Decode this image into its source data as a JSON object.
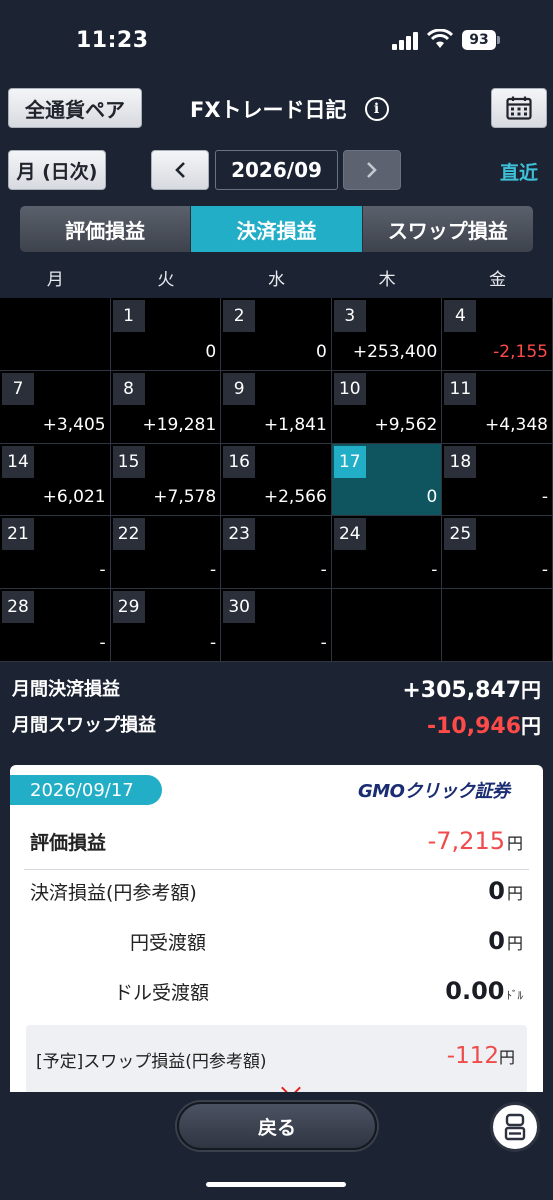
{
  "status": {
    "time": "11:23",
    "battery": "93"
  },
  "header": {
    "pair_button": "全通貨ペア",
    "title": "FXトレード日記",
    "info_icon": "info-icon",
    "calendar_icon": "calendar-icon"
  },
  "nav": {
    "mode_button": "月 (日次)",
    "prev": "<",
    "current": "2026/09",
    "next": ">",
    "recent": "直近"
  },
  "tabs": [
    "評価損益",
    "決済損益",
    "スワップ損益"
  ],
  "active_tab": 1,
  "calendar": {
    "weekdays": [
      "月",
      "火",
      "水",
      "木",
      "金"
    ],
    "cells": [
      {
        "day": "",
        "value": ""
      },
      {
        "day": "1",
        "value": "0"
      },
      {
        "day": "2",
        "value": "0"
      },
      {
        "day": "3",
        "value": "+253,400"
      },
      {
        "day": "4",
        "value": "-2,155",
        "negative": true
      },
      {
        "day": "7",
        "value": "+3,405"
      },
      {
        "day": "8",
        "value": "+19,281"
      },
      {
        "day": "9",
        "value": "+1,841"
      },
      {
        "day": "10",
        "value": "+9,562"
      },
      {
        "day": "11",
        "value": "+4,348"
      },
      {
        "day": "14",
        "value": "+6,021"
      },
      {
        "day": "15",
        "value": "+7,578"
      },
      {
        "day": "16",
        "value": "+2,566"
      },
      {
        "day": "17",
        "value": "0",
        "today": true
      },
      {
        "day": "18",
        "value": "-"
      },
      {
        "day": "21",
        "value": "-"
      },
      {
        "day": "22",
        "value": "-"
      },
      {
        "day": "23",
        "value": "-"
      },
      {
        "day": "24",
        "value": "-"
      },
      {
        "day": "25",
        "value": "-"
      },
      {
        "day": "28",
        "value": "-"
      },
      {
        "day": "29",
        "value": "-"
      },
      {
        "day": "30",
        "value": "-"
      },
      {
        "day": "",
        "value": ""
      },
      {
        "day": "",
        "value": ""
      }
    ]
  },
  "summary": {
    "settlement_label": "月間決済損益",
    "settlement_value": "+305,847",
    "swap_label": "月間スワップ損益",
    "swap_value": "-10,946",
    "yen": "円"
  },
  "detail": {
    "date": "2026/09/17",
    "brand": "GMOクリック証券",
    "rows": [
      {
        "label": "評価損益",
        "value": "-7,215",
        "unit": "円"
      },
      {
        "label": "決済損益(円参考額)",
        "value": "0",
        "unit": "円"
      },
      {
        "label": "円受渡額",
        "value": "0",
        "unit": "円"
      },
      {
        "label": "ドル受渡額",
        "value": "0.00",
        "unit": "ﾄﾞﾙ"
      }
    ],
    "swap_label": "[予定]スワップ損益(円参考額)",
    "swap_value": "-112",
    "swap_unit": "円"
  },
  "bottom": {
    "back": "戻る",
    "float_icon": "chat-icon"
  },
  "colors": {
    "accent": "#22aec6",
    "negative": "#ff4a4a",
    "background": "#1c2332"
  }
}
